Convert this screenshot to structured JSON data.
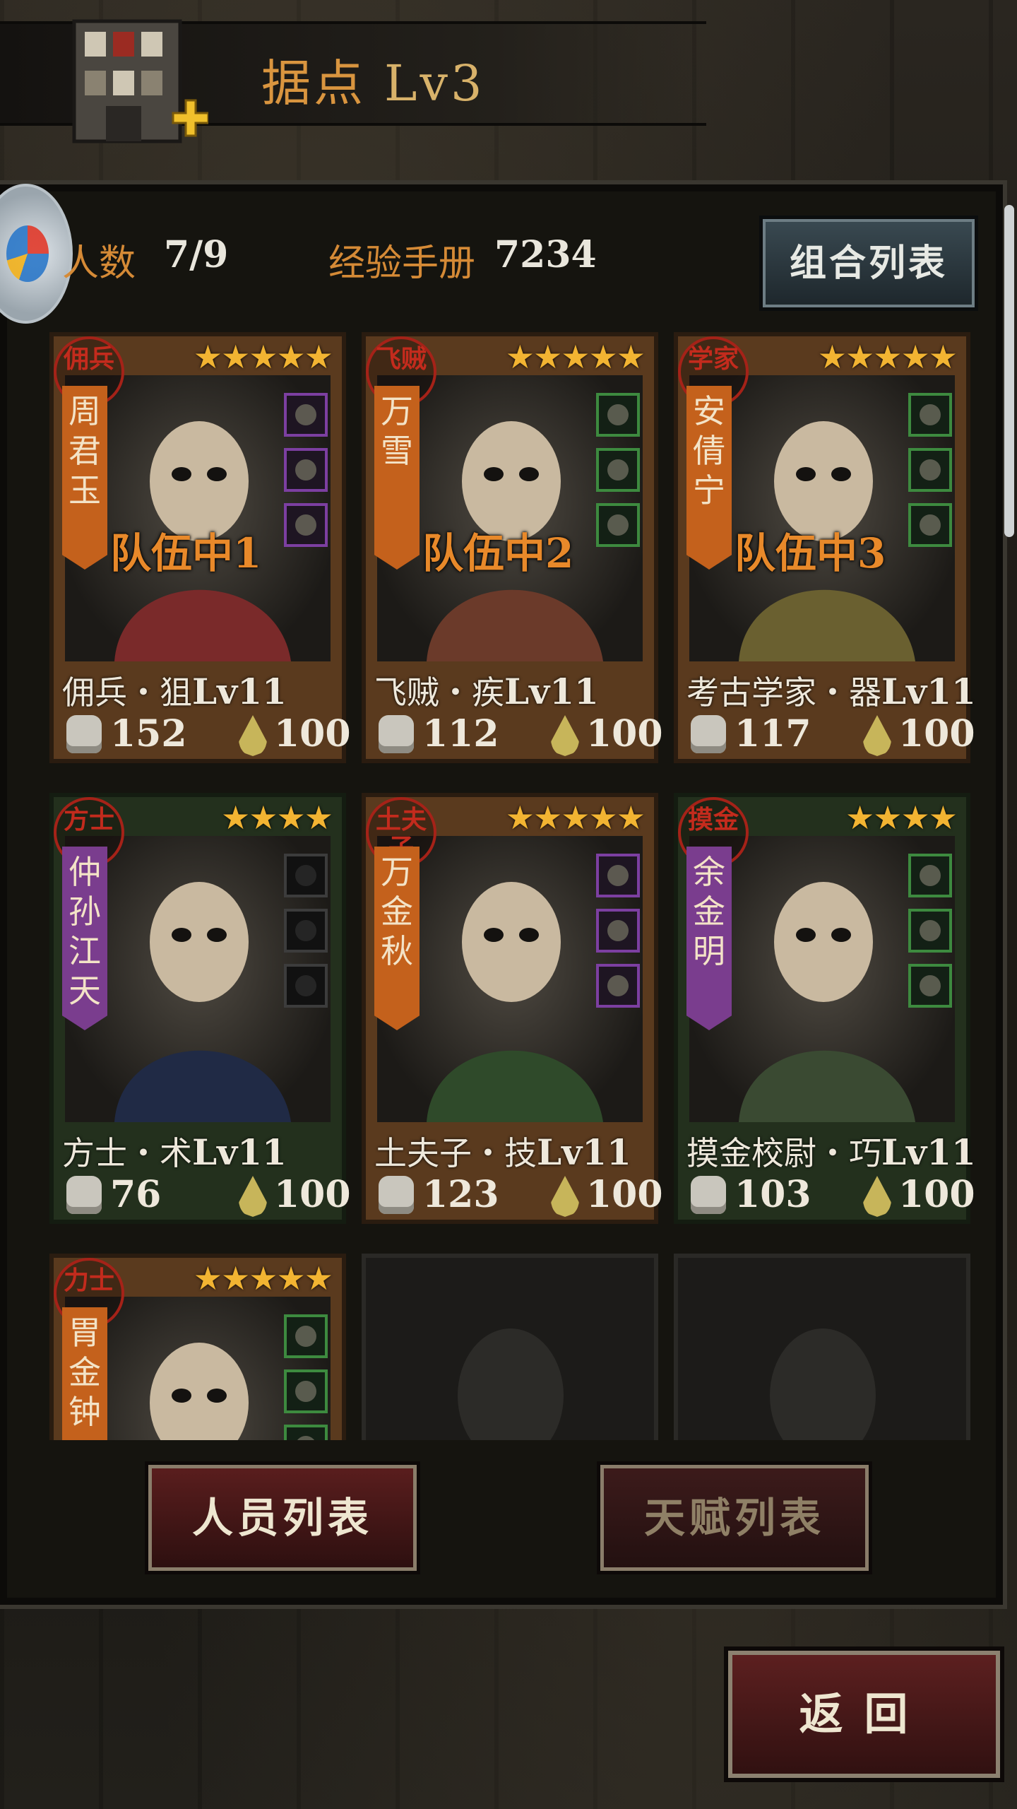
{
  "header": {
    "title": "据点",
    "level": "Lv3"
  },
  "stats": {
    "people_label": "人数",
    "people_value": "7/9",
    "exp_label": "经验手册",
    "exp_value": "7234"
  },
  "combo_button": "组合列表",
  "cards": [
    {
      "seal": "佣兵",
      "name_vertical": "周君玉",
      "team": "队伍中1",
      "stars": "★★★★★",
      "title": "佣兵・狙",
      "level": "Lv11",
      "attack": "152",
      "hp": "100",
      "style": "orange",
      "banner": "orange",
      "equip": "purple"
    },
    {
      "seal": "飞贼",
      "name_vertical": "万雪",
      "team": "队伍中2",
      "stars": "★★★★★",
      "title": "飞贼・疾",
      "level": "Lv11",
      "attack": "112",
      "hp": "100",
      "style": "orange",
      "banner": "orange",
      "equip": "green"
    },
    {
      "seal": "学家",
      "name_vertical": "安倩宁",
      "team": "队伍中3",
      "stars": "★★★★★",
      "title": "考古学家・器",
      "level": "Lv11",
      "attack": "117",
      "hp": "100",
      "style": "orange",
      "banner": "orange",
      "equip": "green"
    },
    {
      "seal": "方士",
      "name_vertical": "仲孙江天",
      "team": "",
      "stars": "★★★★",
      "title": "方士・术",
      "level": "Lv11",
      "attack": "76",
      "hp": "100",
      "style": "green",
      "banner": "purple",
      "equip": "empty"
    },
    {
      "seal": "土夫子",
      "name_vertical": "万金秋",
      "team": "",
      "stars": "★★★★★",
      "title": "土夫子・技",
      "level": "Lv11",
      "attack": "123",
      "hp": "100",
      "style": "orange",
      "banner": "orange",
      "equip": "purple"
    },
    {
      "seal": "摸金",
      "name_vertical": "余金明",
      "team": "",
      "stars": "★★★★",
      "title": "摸金校尉・巧",
      "level": "Lv11",
      "attack": "103",
      "hp": "100",
      "style": "green",
      "banner": "purple",
      "equip": "green"
    },
    {
      "seal": "力士",
      "name_vertical": "胃金钟",
      "team": "",
      "stars": "★★★★★",
      "title": "",
      "level": "",
      "attack": "",
      "hp": "",
      "style": "orange",
      "banner": "orange",
      "equip": "green"
    }
  ],
  "buttons": {
    "personnel_list": "人员列表",
    "talent_list": "天赋列表",
    "back": "返回"
  },
  "colors": {
    "accent_orange": "#d58a36",
    "star_gold": "#f2b432",
    "seal_red": "#a52218"
  }
}
